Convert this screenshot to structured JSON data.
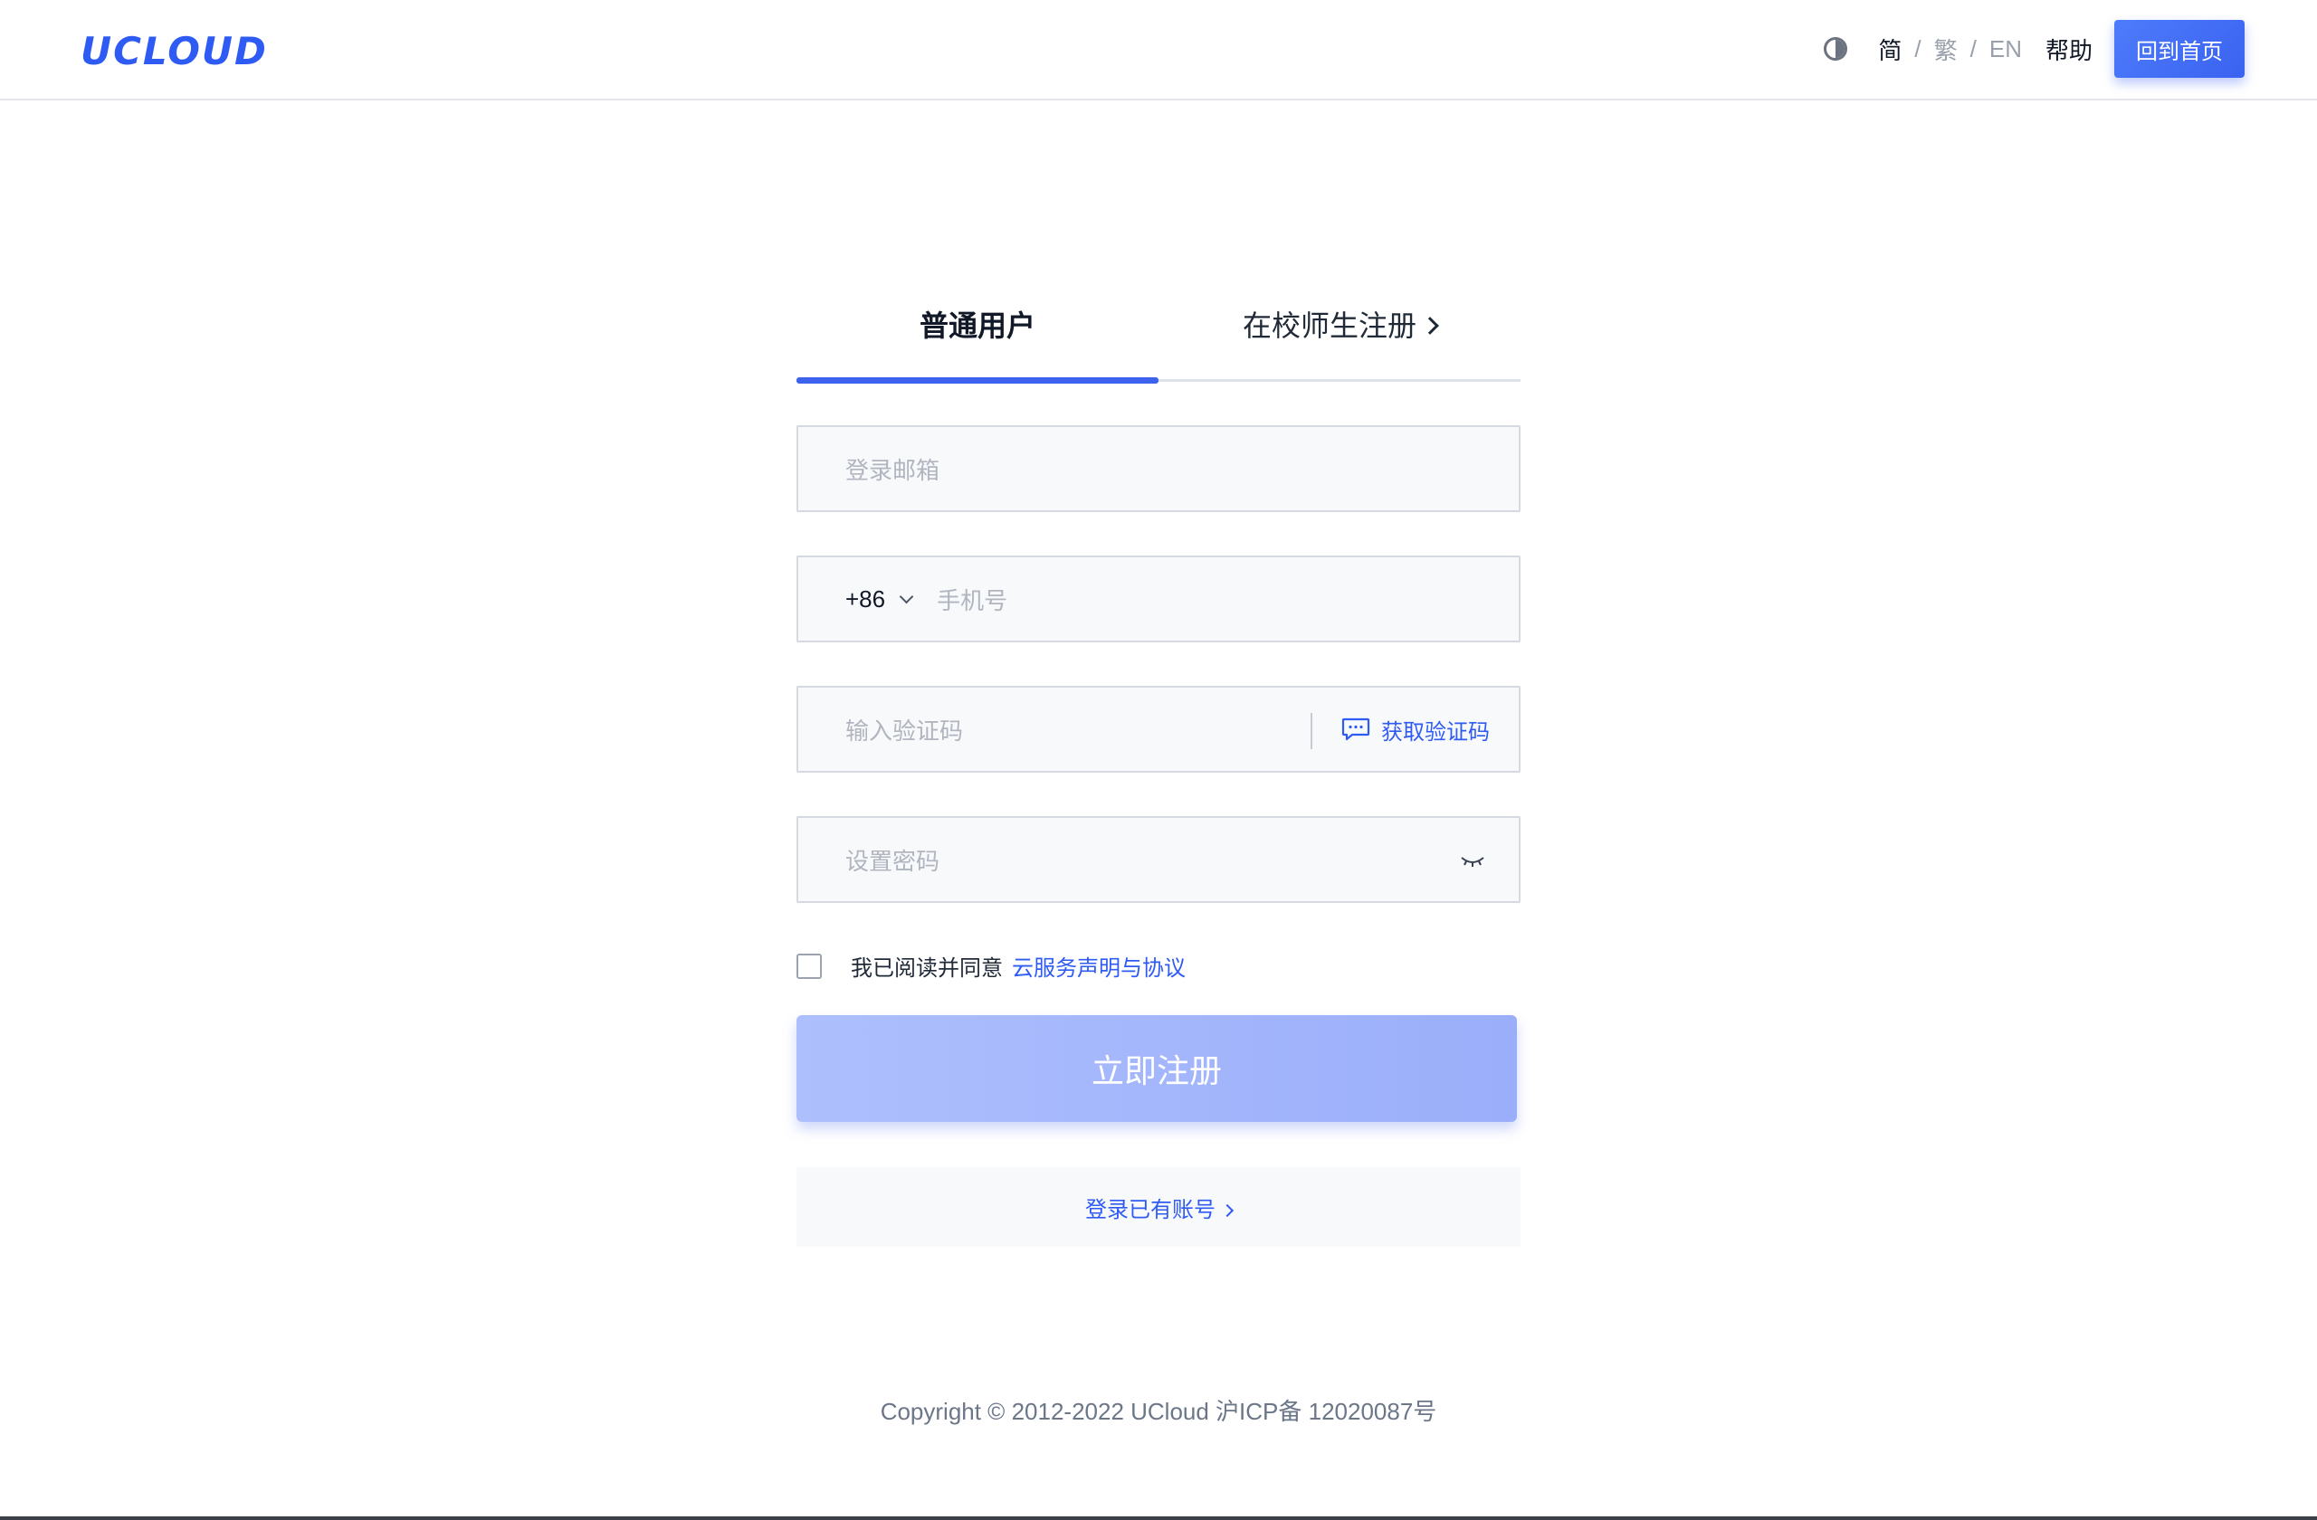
{
  "header": {
    "logo_text": "UCLOUD",
    "languages": [
      "简",
      "繁",
      "EN"
    ],
    "lang_separator": "/",
    "help_label": "帮助",
    "home_button_label": "回到首页"
  },
  "tabs": [
    {
      "label": "普通用户",
      "active": true
    },
    {
      "label": "在校师生注册",
      "active": false
    }
  ],
  "form": {
    "email_placeholder": "登录邮箱",
    "country_code": "+86",
    "phone_placeholder": "手机号",
    "code_placeholder": "输入验证码",
    "get_code_label": "获取验证码",
    "password_placeholder": "设置密码",
    "agree_text": "我已阅读并同意",
    "agree_link": "云服务声明与协议",
    "submit_label": "立即注册",
    "login_link": "登录已有账号"
  },
  "footer": {
    "copyright": "Copyright © 2012-2022 UCloud 沪ICP备 12020087号"
  },
  "colors": {
    "accent": "#2e5bf4",
    "submit_disabled": "#a5b8fc",
    "field_bg": "#f8f9fb"
  },
  "icons": {
    "theme": "contrast-icon",
    "code": "chat-icon",
    "password": "eye-closed-icon"
  }
}
